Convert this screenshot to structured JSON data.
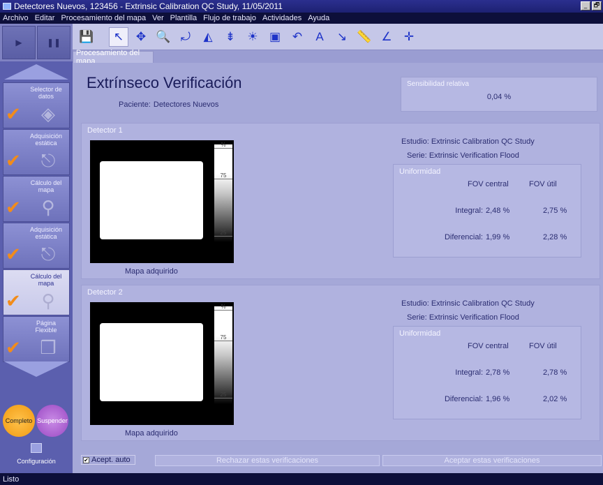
{
  "window": {
    "title": "Detectores Nuevos, 123456 - Extrinsic Calibration QC Study, 11/05/2011",
    "controls": [
      "_",
      "🗗"
    ]
  },
  "menu": [
    "Archivo",
    "Editar",
    "Procesamiento del mapa",
    "Ver",
    "Plantilla",
    "Flujo de trabajo",
    "Actividades",
    "Ayuda"
  ],
  "transport": {
    "play": "▶",
    "pause": "❚❚"
  },
  "toolbar": {
    "tools": [
      {
        "name": "save-icon",
        "glyph": "💾"
      },
      {
        "name": "pointer-icon",
        "glyph": "↖"
      },
      {
        "name": "pan-icon",
        "glyph": "✥"
      },
      {
        "name": "zoom-icon",
        "glyph": "🔍"
      },
      {
        "name": "rotate-icon",
        "glyph": "⤾"
      },
      {
        "name": "flip-horizontal-icon",
        "glyph": "◭"
      },
      {
        "name": "flip-vertical-icon",
        "glyph": "⇟"
      },
      {
        "name": "brightness-icon",
        "glyph": "☀"
      },
      {
        "name": "roi-icon",
        "glyph": "▣"
      },
      {
        "name": "reset-icon",
        "glyph": "↶"
      },
      {
        "name": "annotation-icon",
        "glyph": "A"
      },
      {
        "name": "arrow-annotation-icon",
        "glyph": "↘"
      },
      {
        "name": "ruler-icon",
        "glyph": "📏"
      },
      {
        "name": "angle-icon",
        "glyph": "∠"
      },
      {
        "name": "crosshair-icon",
        "glyph": "✛"
      }
    ]
  },
  "tab": {
    "label": "Procesamiento del mapa"
  },
  "sidebar": {
    "steps": [
      {
        "label": "Selector de datos",
        "icon": "data-selector-icon",
        "glyph": "◈",
        "active": false
      },
      {
        "label": "Adquisición estática",
        "icon": "static-acquisition-icon",
        "glyph": "⎋",
        "active": false
      },
      {
        "label": "Cálculo del mapa",
        "icon": "map-calc-icon",
        "glyph": "⚲",
        "active": false
      },
      {
        "label": "Adquisición estática",
        "icon": "static-acquisition-icon",
        "glyph": "⎋",
        "active": false
      },
      {
        "label": "Cálculo del mapa",
        "icon": "map-calc-icon",
        "glyph": "⚲",
        "active": true
      },
      {
        "label": "Página Flexible",
        "icon": "flexible-page-icon",
        "glyph": "❒",
        "active": false
      }
    ],
    "complete_label": "Completo",
    "suspend_label": "Suspender",
    "config_label": "Configuración"
  },
  "main": {
    "title": "Extrínseco Verificación",
    "patient_label": "Paciente:",
    "patient_name": "Detectores Nuevos",
    "sensitivity": {
      "title": "Sensibilidad relativa",
      "value": "0,04 %"
    },
    "scale_ticks": [
      "%",
      "75",
      "25"
    ],
    "detectors": [
      {
        "title": "Detector 1",
        "map_label": "Mapa adquirido",
        "study_label": "Estudio:",
        "study_value": "Extrinsic Calibration QC Study",
        "series_label": "Serie:",
        "series_value": "Extrinsic Verification Flood",
        "uniformity": {
          "title": "Uniformidad",
          "col_central": "FOV central",
          "col_util": "FOV útil",
          "integral_label": "Integral:",
          "integral_central": "2,48 %",
          "integral_util": "2,75 %",
          "diferencial_label": "Diferencial:",
          "diferencial_central": "1,99 %",
          "diferencial_util": "2,28 %"
        }
      },
      {
        "title": "Detector 2",
        "map_label": "Mapa adquirido",
        "study_label": "Estudio:",
        "study_value": "Extrinsic Calibration QC Study",
        "series_label": "Serie:",
        "series_value": "Extrinsic Verification Flood",
        "uniformity": {
          "title": "Uniformidad",
          "col_central": "FOV central",
          "col_util": "FOV útil",
          "integral_label": "Integral:",
          "integral_central": "2,78 %",
          "integral_util": "2,78 %",
          "diferencial_label": "Diferencial:",
          "diferencial_central": "1,96 %",
          "diferencial_util": "2,02 %"
        }
      }
    ]
  },
  "bottom": {
    "auto_accept_label": "Acept. auto",
    "auto_accept_checked": "✔",
    "reject_label": "Rechazar estas verificaciones",
    "accept_label": "Aceptar estas verificaciones"
  },
  "status": {
    "text": "Listo"
  }
}
